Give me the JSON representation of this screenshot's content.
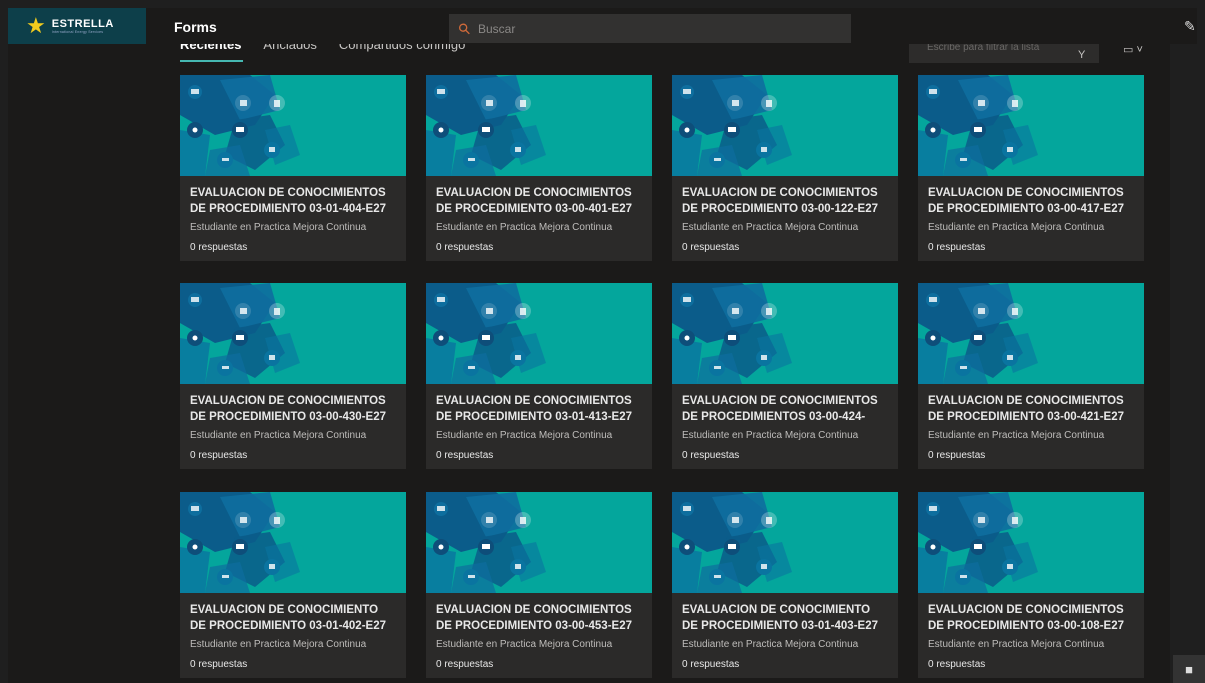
{
  "app": {
    "brand_name": "ESTRELLA",
    "brand_sub": "International Energy Services",
    "title": "Forms"
  },
  "search": {
    "placeholder": "Buscar"
  },
  "tabs": [
    {
      "label": "Recientes",
      "active": true
    },
    {
      "label": "Anclados",
      "active": false
    },
    {
      "label": "Compartidos conmigo",
      "active": false
    }
  ],
  "filter": {
    "placeholder": "Escribe para filtrar la lista"
  },
  "colors": {
    "accent": "#46b8b2",
    "thumb": "#04a69c",
    "star": "#f2cc1d"
  },
  "cards": [
    {
      "title1": "EVALUACION  DE CONOCIMIENTOS",
      "title2": "DE PROCEDIMIENTO 03-01-404-E27",
      "owner": "Estudiante en Practica Mejora Continua",
      "responses": "0 respuestas"
    },
    {
      "title1": "EVALUACION DE CONOCIMIENTOS",
      "title2": "DE PROCEDIMIENTO 03-00-401-E27",
      "owner": "Estudiante en Practica Mejora Continua",
      "responses": "0 respuestas"
    },
    {
      "title1": "EVALUACION DE CONOCIMIENTOS",
      "title2": "DE PROCEDIMIENTO 03-00-122-E27",
      "owner": "Estudiante en Practica Mejora Continua",
      "responses": "0 respuestas"
    },
    {
      "title1": "EVALUACION DE CONOCIMIENTOS",
      "title2": "DE PROCEDIMIENTO 03-00-417-E27",
      "owner": "Estudiante en Practica Mejora Continua",
      "responses": "0 respuestas"
    },
    {
      "title1": "EVALUACION  DE CONOCIMIENTOS",
      "title2": "DE PROCEDIMIENTO  03-00-430-E27",
      "owner": "Estudiante en Practica Mejora Continua",
      "responses": "0 respuestas"
    },
    {
      "title1": "EVALUACION DE CONOCIMIENTOS",
      "title2": "DE PROCEDIMIENTO 03-01-413-E27",
      "owner": "Estudiante en Practica Mejora Continua",
      "responses": "0 respuestas"
    },
    {
      "title1": "EVALUACION DE  CONOCIMIENTOS",
      "title2": "DE PROCEDIMIENTOS 03-00-424-",
      "owner": "Estudiante en Practica Mejora Continua",
      "responses": "0 respuestas"
    },
    {
      "title1": "EVALUACION DE CONOCIMIENTOS",
      "title2": "DE PROCEDIMIENTO 03-00-421-E27",
      "owner": "Estudiante en Practica Mejora Continua",
      "responses": "0 respuestas"
    },
    {
      "title1": "EVALUACION DE CONOCIMIENTO",
      "title2": "DE PROCEDIMIENTO 03-01-402-E27",
      "owner": "Estudiante en Practica Mejora Continua",
      "responses": "0 respuestas"
    },
    {
      "title1": "EVALUACION DE CONOCIMIENTOS",
      "title2": "DE PROCEDIMIENTO  03-00-453-E27",
      "owner": "Estudiante en Practica Mejora Continua",
      "responses": "0 respuestas"
    },
    {
      "title1": "EVALUACION DE CONOCIMIENTO",
      "title2": "DE PROCEDIMIENTO 03-01-403-E27",
      "owner": "Estudiante en Practica Mejora Continua",
      "responses": "0 respuestas"
    },
    {
      "title1": "EVALUACION DE CONOCIMIENTOS",
      "title2": "DE PROCEDIMIENTO 03-00-108-E27",
      "owner": "Estudiante en Practica Mejora Continua",
      "responses": "0 respuestas"
    }
  ]
}
